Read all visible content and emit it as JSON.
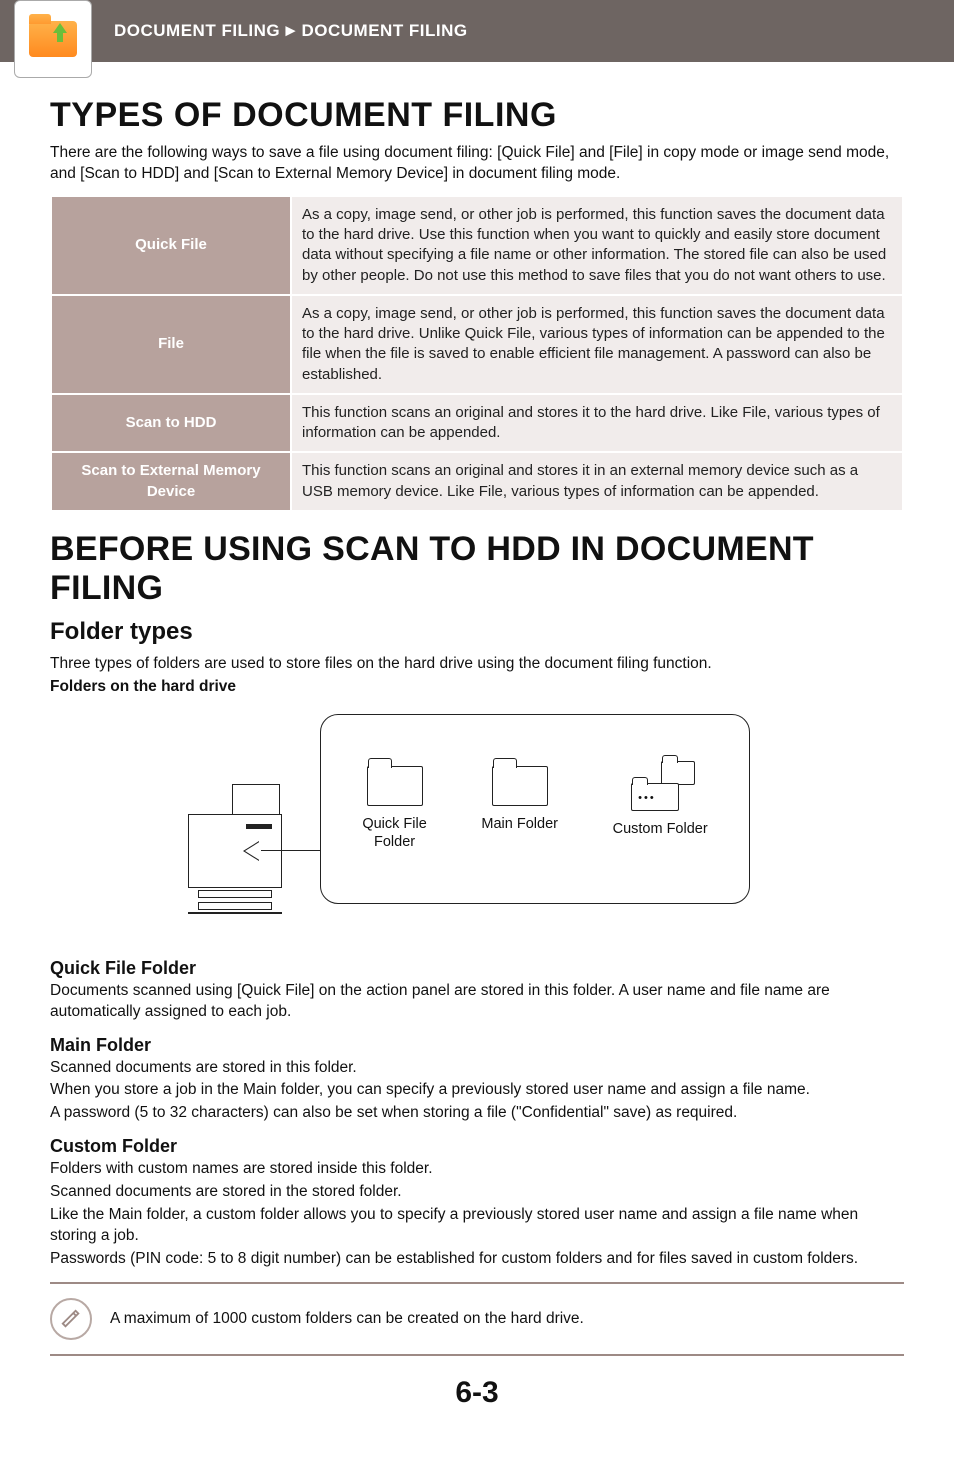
{
  "header": {
    "breadcrumb_section": "DOCUMENT FILING",
    "breadcrumb_sep": "►",
    "breadcrumb_page": "DOCUMENT FILING"
  },
  "types": {
    "heading": "TYPES OF DOCUMENT FILING",
    "intro": "There are the following ways to save a file using document filing: [Quick File] and [File] in copy mode or image send mode, and [Scan to HDD] and [Scan to External Memory Device] in document filing mode.",
    "rows": [
      {
        "label": "Quick File",
        "desc": "As a copy, image send, or other job is performed, this function saves the document data to the hard drive. Use this function when you want to quickly and easily store document data without specifying a file name or other information. The stored file can also be used by other people. Do not use this method to save files that you do not want others to use."
      },
      {
        "label": "File",
        "desc": "As a copy, image send, or other job is performed, this function saves the document data to the hard drive. Unlike Quick File, various types of information can be appended to the file when the file is saved to enable efficient file management. A password can also be established."
      },
      {
        "label": "Scan to HDD",
        "desc": "This function scans an original and stores it to the hard drive. Like File, various types of information can be appended."
      },
      {
        "label": "Scan to External Memory Device",
        "desc": "This function scans an original and stores it in an external memory device such as a USB memory device. Like File, various types of information can be appended."
      }
    ]
  },
  "before": {
    "heading": "BEFORE USING SCAN TO HDD IN DOCUMENT FILING",
    "folder_types_heading": "Folder types",
    "folder_types_intro": "Three types of folders are used to store files on the hard drive using the document filing function.",
    "folders_label": "Folders on the hard drive",
    "diagram": {
      "quick_file_folder_line1": "Quick File",
      "quick_file_folder_line2": "Folder",
      "main_folder": "Main Folder",
      "custom_folder": "Custom Folder"
    },
    "quick_file": {
      "heading": "Quick File Folder",
      "body": "Documents scanned using [Quick File] on the action panel are stored in this folder. A user name and file name are automatically assigned to each job."
    },
    "main_folder": {
      "heading": "Main Folder",
      "body1": "Scanned documents are stored in this folder.",
      "body2": "When you store a job in the Main folder, you can specify a previously stored user name and assign a file name.",
      "body3": "A password (5 to 32 characters) can also be set when storing a file (\"Confidential\" save) as required."
    },
    "custom_folder": {
      "heading": "Custom Folder",
      "body1": "Folders with custom names are stored inside this folder.",
      "body2": "Scanned documents are stored in the stored folder.",
      "body3": "Like the Main folder, a custom folder allows you to specify a previously stored user name and assign a file name when storing a job.",
      "body4": "Passwords (PIN code: 5 to 8 digit number) can be established for custom folders and for files saved in custom folders."
    },
    "note": "A maximum of 1000 custom folders can be created on the hard drive."
  },
  "page_number": "6-3"
}
